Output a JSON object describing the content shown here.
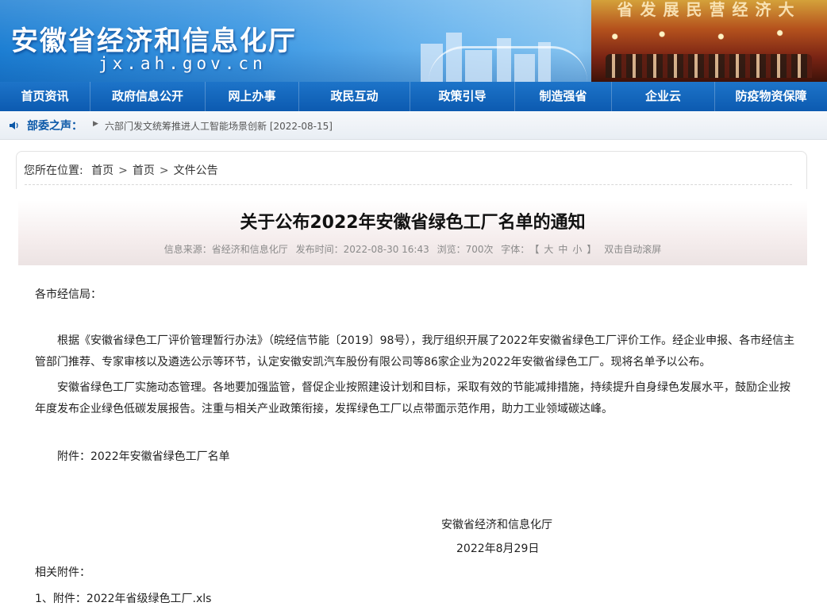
{
  "header": {
    "site_title": "安徽省经济和信息化厅",
    "domain": "jx.ah.gov.cn",
    "banner_slogan": "省发展民营经济大"
  },
  "nav": [
    {
      "label": "首页资讯"
    },
    {
      "label": "政府信息公开"
    },
    {
      "label": "网上办事"
    },
    {
      "label": "政民互动"
    },
    {
      "label": "政策引导"
    },
    {
      "label": "制造强省"
    },
    {
      "label": "企业云"
    },
    {
      "label": "防疫物资保障"
    }
  ],
  "notice": {
    "label": "部委之声：",
    "text": "六部门发文统筹推进人工智能场景创新 [2022-08-15]"
  },
  "breadcrumb": {
    "prefix": "您所在位置:",
    "items": [
      "首页",
      "首页",
      "文件公告"
    ],
    "separator": ">"
  },
  "article": {
    "title": "关于公布2022年安徽省绿色工厂名单的通知",
    "meta": {
      "source": "信息来源：省经济和信息化厅",
      "published": "发布时间：2022-08-30 16:43",
      "views": "浏览：700次",
      "font_label": "字体：",
      "font_size_open": "【",
      "font_large": "大",
      "font_medium": "中",
      "font_small": "小",
      "font_size_close": "】",
      "auto_scroll": "双击自动滚屏"
    },
    "greeting": "各市经信局：",
    "paragraph1": "根据《安徽省绿色工厂评价管理暂行办法》（皖经信节能〔2019〕98号），我厅组织开展了2022年安徽省绿色工厂评价工作。经企业申报、各市经信主管部门推荐、专家审核以及遴选公示等环节，认定安徽安凯汽车股份有限公司等86家企业为2022年安徽省绿色工厂。现将名单予以公布。",
    "paragraph2": "安徽省绿色工厂实施动态管理。各地要加强监管，督促企业按照建设计划和目标，采取有效的节能减排措施，持续提升自身绿色发展水平，鼓励企业按年度发布企业绿色低碳发展报告。注重与相关产业政策衔接，发挥绿色工厂以点带面示范作用，助力工业领域碳达峰。",
    "attachment_note": "附件：2022年安徽省绿色工厂名单",
    "signature_org": "安徽省经济和信息化厅",
    "signature_date": "2022年8月29日",
    "related_label": "相关附件：",
    "attachments": [
      "1、附件：2022年省级绿色工厂.xls"
    ]
  },
  "colors": {
    "nav_bg": "#0c5ab0",
    "notice_label": "#0b58a8",
    "meta_text": "#8a8a8a"
  }
}
